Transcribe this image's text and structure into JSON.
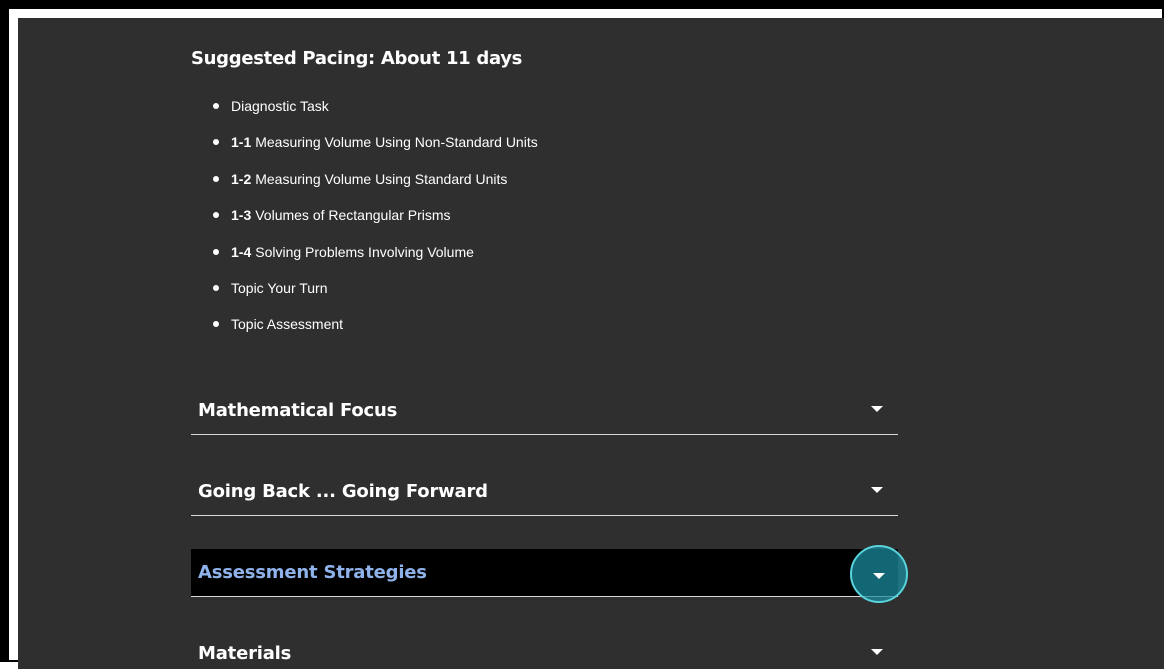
{
  "pacing": {
    "title": "Suggested Pacing: About 11 days",
    "items": [
      {
        "num": "",
        "text": "Diagnostic Task"
      },
      {
        "num": "1-1",
        "text": "Measuring Volume Using Non-Standard Units"
      },
      {
        "num": "1-2",
        "text": "Measuring Volume Using Standard Units"
      },
      {
        "num": "1-3",
        "text": "Volumes of Rectangular Prisms"
      },
      {
        "num": "1-4",
        "text": "Solving Problems Involving Volume"
      },
      {
        "num": "",
        "text": "Topic Your Turn"
      },
      {
        "num": "",
        "text": "Topic Assessment"
      }
    ]
  },
  "accordions": [
    {
      "label": "Mathematical Focus",
      "expanded": false,
      "focused": false
    },
    {
      "label": "Going Back ... Going Forward",
      "expanded": false,
      "focused": false
    },
    {
      "label": "Assessment Strategies",
      "expanded": false,
      "focused": true
    },
    {
      "label": "Materials",
      "expanded": false,
      "focused": false
    }
  ],
  "colors": {
    "background": "#2f2f2f",
    "active_label": "#8fb2ea",
    "focus_ring": "#58d3dc",
    "focus_fill": "#1a8ea0"
  },
  "icons": {
    "list_bullet": "bullet-icon",
    "accordion_toggle": "caret-down-icon"
  }
}
